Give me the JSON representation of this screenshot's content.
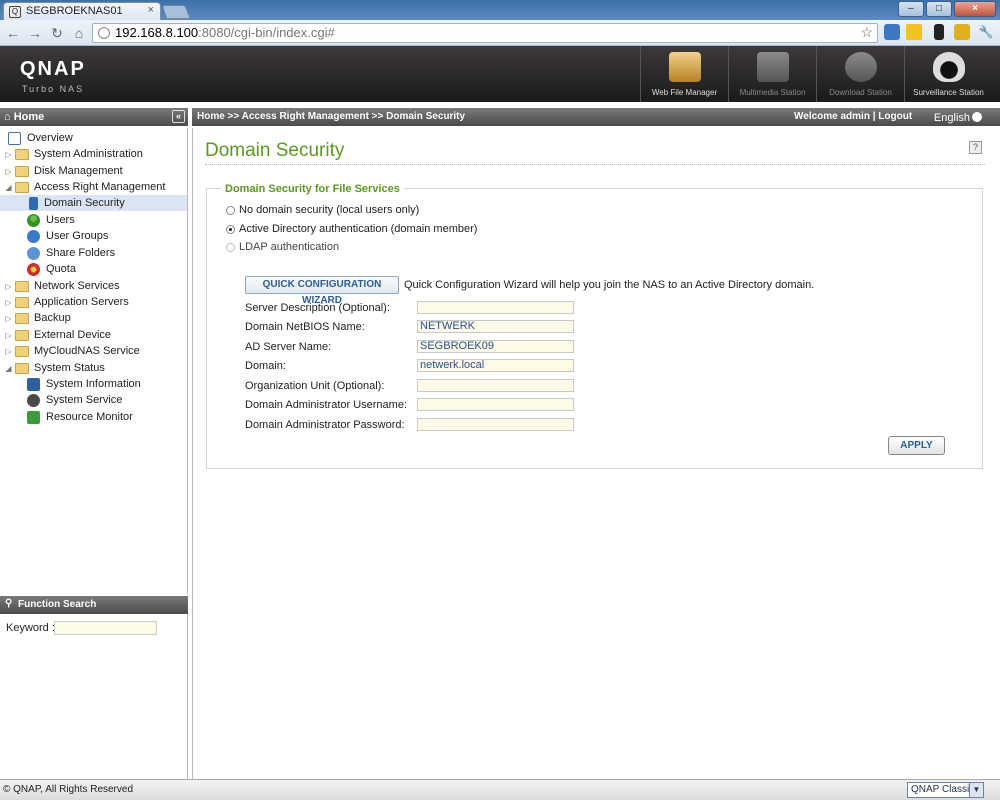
{
  "browser": {
    "tab_title": "SEGBROEKNAS01",
    "tab_close": "×",
    "url_host": "192.168.8.100",
    "url_rest": ":8080/cgi-bin/index.cgi#",
    "back": "←",
    "forward": "→",
    "reload": "↻",
    "home": "⌂",
    "star": "☆",
    "window_buttons": {
      "minimize": "–",
      "maximize": "□",
      "close": "×"
    },
    "extensions": [
      "extension-icon-1",
      "extension-icon-2",
      "extension-icon-3",
      "extension-icon-4",
      "wrench-icon"
    ]
  },
  "header": {
    "brand": "QNAP",
    "subtitle": "Turbo NAS",
    "apps": [
      {
        "label": "Web File Manager",
        "color": "#c99a3b",
        "enabled": true
      },
      {
        "label": "Multimedia Station",
        "color": "#6d6d6d",
        "enabled": false
      },
      {
        "label": "Download Station",
        "color": "#6d6d6d",
        "enabled": false
      },
      {
        "label": "Surveillance Station",
        "color": "#e8e8e8",
        "enabled": true
      }
    ]
  },
  "sidebar": {
    "home_label": "Home",
    "collapse": "«",
    "items": [
      {
        "label": "Overview"
      },
      {
        "label": "System Administration"
      },
      {
        "label": "Disk Management"
      },
      {
        "label": "Access Right Management"
      },
      {
        "label": "Domain Security"
      },
      {
        "label": "Users"
      },
      {
        "label": "User Groups"
      },
      {
        "label": "Share Folders"
      },
      {
        "label": "Quota"
      },
      {
        "label": "Network Services"
      },
      {
        "label": "Application Servers"
      },
      {
        "label": "Backup"
      },
      {
        "label": "External Device"
      },
      {
        "label": "MyCloudNAS Service"
      },
      {
        "label": "System Status"
      },
      {
        "label": "System Information"
      },
      {
        "label": "System Service"
      },
      {
        "label": "Resource Monitor"
      }
    ]
  },
  "function_search": {
    "title": "Function Search",
    "keyword_label": "Keyword :",
    "keyword_value": ""
  },
  "breadcrumb": {
    "path": "Home >> Access Right Management >> Domain Security",
    "welcome": "Welcome admin | Logout",
    "language": "English"
  },
  "page": {
    "title": "Domain Security",
    "help": "?",
    "section_title": "Domain Security for File Services",
    "options": [
      {
        "label": "No domain security (local users only)",
        "selected": false
      },
      {
        "label": "Active Directory authentication (domain member)",
        "selected": true
      },
      {
        "label": "LDAP authentication",
        "selected": false
      }
    ],
    "wizard_button": "QUICK CONFIGURATION WIZARD",
    "wizard_description": "Quick Configuration Wizard will help you join the NAS to an Active Directory domain.",
    "fields": [
      {
        "label": "Server Description (Optional):",
        "value": ""
      },
      {
        "label": "Domain NetBIOS Name:",
        "value": "NETWERK"
      },
      {
        "label": "AD Server Name:",
        "value": "SEGBROEK09"
      },
      {
        "label": "Domain:",
        "value": "netwerk.local"
      },
      {
        "label": "Organization Unit (Optional):",
        "value": ""
      },
      {
        "label": "Domain Administrator Username:",
        "value": ""
      },
      {
        "label": "Domain Administrator Password:",
        "value": ""
      }
    ],
    "apply_button": "APPLY"
  },
  "footer": {
    "copyright": "© QNAP, All Rights Reserved",
    "ui_mode": "QNAP Classic"
  },
  "colors": {
    "accent_green": "#5a9a1e",
    "link_blue": "#2a5da0"
  }
}
